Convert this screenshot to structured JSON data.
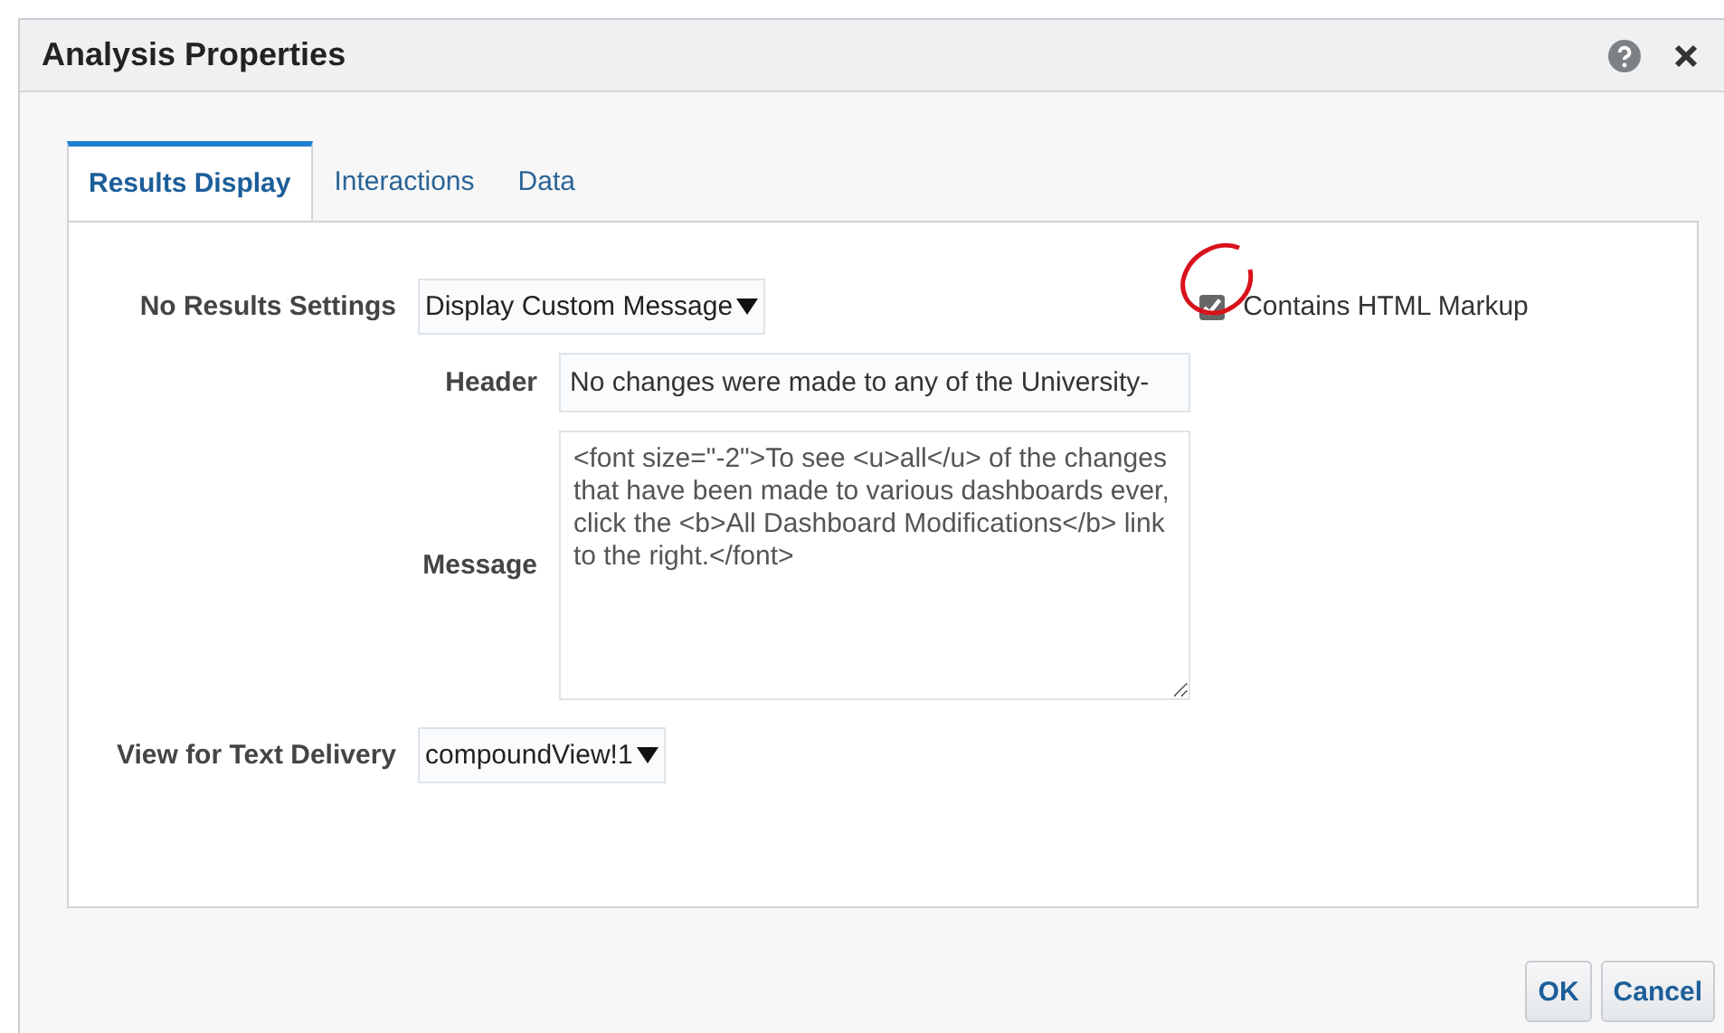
{
  "dialog": {
    "title": "Analysis Properties"
  },
  "tabs": [
    {
      "label": "Results Display",
      "selected": true
    },
    {
      "label": "Interactions",
      "selected": false
    },
    {
      "label": "Data",
      "selected": false
    }
  ],
  "no_results_settings": {
    "label": "No Results Settings",
    "value": "Display Custom Message"
  },
  "contains_html_markup": {
    "label": "Contains HTML Markup",
    "checked": true
  },
  "header": {
    "label": "Header",
    "value": "No changes were made to any of the University-"
  },
  "message": {
    "label": "Message",
    "value": "<font size=\"-2\">To see <u>all</u> of the changes that have been made to various dashboards ever, click the <b>All Dashboard Modifications</b> link to the right.</font>"
  },
  "view_for_text_delivery": {
    "label": "View for Text Delivery",
    "value": "compoundView!1"
  },
  "buttons": [
    {
      "label": "OK"
    },
    {
      "label": "Cancel"
    }
  ]
}
